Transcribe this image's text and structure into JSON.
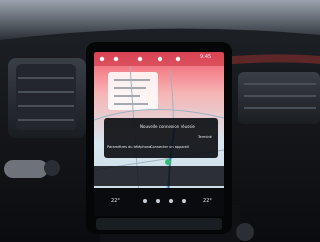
{
  "photo": {
    "subject": "car-dashboard-infotainment-touchscreen"
  },
  "screen": {
    "status_time": "9:45",
    "route_panel": {
      "destination_line": "",
      "eta_line": ""
    },
    "dialog": {
      "message": "Nouvelle connexion réussie",
      "left_action": "Paramètres du téléphone",
      "middle_action": "Connecter un appareil",
      "right_action": "Terminé"
    },
    "bottom_bar": {
      "left_info": "",
      "right_info": ""
    },
    "climate_bar": {
      "left_temp": "22°",
      "right_temp": "22°"
    }
  },
  "colors": {
    "map_gradient_top": "#f05a6a",
    "map_gradient_mid": "#f7b4b4",
    "map_base": "#d7e6ef",
    "dialog_bg": "#0f1116",
    "dashboard": "#121418",
    "screen_bezel": "#050607"
  }
}
